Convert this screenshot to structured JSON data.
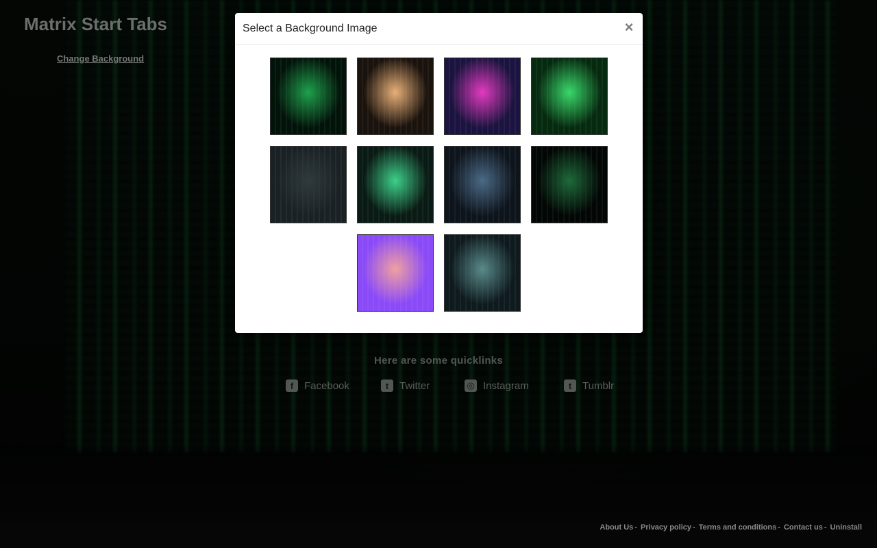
{
  "app": {
    "title": "Matrix Start Tabs",
    "change_background_label": "Change Background"
  },
  "quicklinks": {
    "title": "Here are some quicklinks",
    "items": [
      {
        "label": "Facebook",
        "icon": "facebook-icon",
        "glyph": "f"
      },
      {
        "label": "Twitter",
        "icon": "twitter-icon",
        "glyph": "t"
      },
      {
        "label": "Instagram",
        "icon": "instagram-icon",
        "glyph": "◎"
      },
      {
        "label": "Tumblr",
        "icon": "tumblr-icon",
        "glyph": "t"
      }
    ]
  },
  "footer": {
    "links": [
      "About Us",
      "Privacy policy",
      "Terms and conditions",
      "Contact us",
      "Uninstall"
    ],
    "separator": "-"
  },
  "modal": {
    "title": "Select a Background Image",
    "close_glyph": "×",
    "thumbnails": [
      {
        "name": "green-code-rain",
        "colors": [
          "#02140a",
          "#1fa04c"
        ]
      },
      {
        "name": "warm-light-tunnel",
        "colors": [
          "#1a120c",
          "#e8b078"
        ]
      },
      {
        "name": "pink-bokeh-lights",
        "colors": [
          "#1c1440",
          "#e23ac0"
        ]
      },
      {
        "name": "green-grid-silhouette",
        "colors": [
          "#062a10",
          "#3ad86a"
        ]
      },
      {
        "name": "dark-laptop-code",
        "colors": [
          "#1a2124",
          "#2f3a3c"
        ]
      },
      {
        "name": "laptop-matrix-screen",
        "colors": [
          "#0a1a14",
          "#3dd08a"
        ]
      },
      {
        "name": "dark-workstation",
        "colors": [
          "#0e141c",
          "#4a6a86"
        ]
      },
      {
        "name": "green-lit-room",
        "colors": [
          "#020604",
          "#1e6a3a"
        ]
      },
      {
        "name": "sunglasses-pink-purple",
        "colors": [
          "#8a4af8",
          "#f0a0a0"
        ]
      },
      {
        "name": "city-night-skyline",
        "colors": [
          "#0e1a1e",
          "#5a8a8a"
        ]
      }
    ]
  }
}
